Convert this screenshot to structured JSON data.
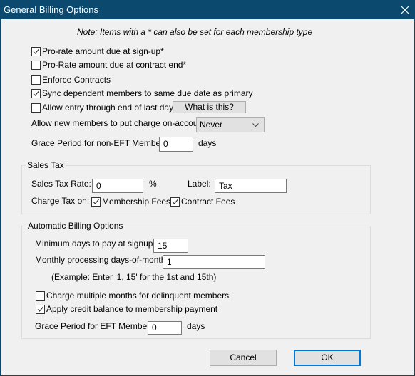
{
  "window": {
    "title": "General Billing Options",
    "close_icon": "close-icon",
    "titlebar_color": "#0b4a6e"
  },
  "note": "Note:  Items with a * can also be set for each membership type",
  "options": [
    {
      "label": "Pro-rate amount due at sign-up*",
      "checked": true
    },
    {
      "label": "Pro-Rate amount due at contract end*",
      "checked": false
    },
    {
      "label": "Enforce Contracts",
      "checked": false
    },
    {
      "label": "Sync dependent members to same due date as primary",
      "checked": true
    },
    {
      "label": "Allow entry through end of last day",
      "checked": false
    }
  ],
  "what_is_this": "What is this?",
  "on_account": {
    "label": "Allow new members to put charge on-account:",
    "value": "Never"
  },
  "grace_non_eft": {
    "label": "Grace Period for non-EFT Members:",
    "value": "0",
    "unit": "days"
  },
  "sales_tax": {
    "legend": "Sales Tax",
    "rate_label": "Sales Tax Rate:",
    "rate_value": "0",
    "rate_unit": "%",
    "label_label": "Label:",
    "label_value": "Tax",
    "charge_on_label": "Charge Tax on:",
    "membership_fees": {
      "label": "Membership Fees",
      "checked": true
    },
    "contract_fees": {
      "label": "Contract Fees",
      "checked": true
    }
  },
  "auto_billing": {
    "legend": "Automatic Billing Options",
    "min_days_label": "Minimum days to pay at signup*:",
    "min_days_value": "15",
    "monthly_label": "Monthly processing days-of-month:",
    "monthly_value": "1",
    "example": "(Example:  Enter  '1, 15' for the 1st and 15th)",
    "charge_multiple": {
      "label": "Charge multiple months for delinquent members",
      "checked": false
    },
    "apply_credit": {
      "label": "Apply credit balance to membership payment",
      "checked": true
    },
    "grace_eft_label": "Grace Period for EFT Members:",
    "grace_eft_value": "0",
    "grace_eft_unit": "days"
  },
  "buttons": {
    "cancel": "Cancel",
    "ok": "OK",
    "ok_border": "#0078d7"
  }
}
